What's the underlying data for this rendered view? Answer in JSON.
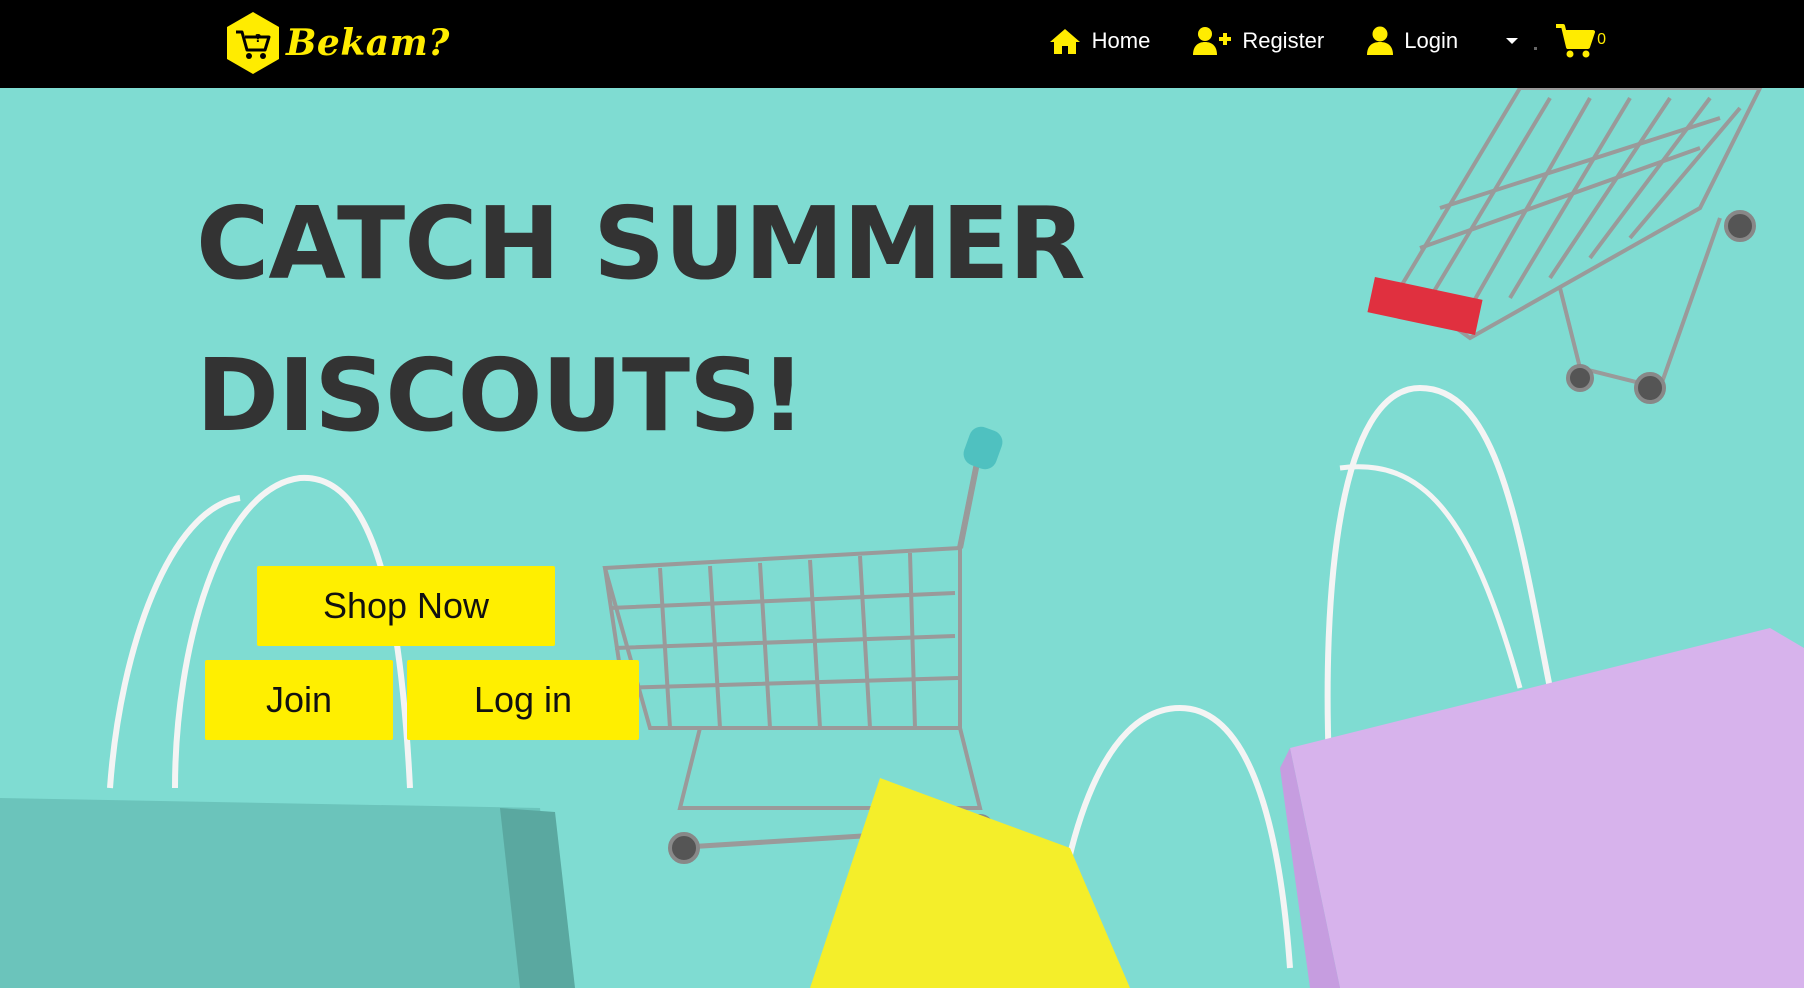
{
  "navbar": {
    "brand_text": "Bekam?",
    "home_label": "Home",
    "register_label": "Register",
    "login_label": "Login",
    "cart_count": "0"
  },
  "hero": {
    "title_line1": "Catch Summer",
    "title_line2": "Discouts!",
    "shop_now_label": "Shop Now",
    "join_label": "Join",
    "login_label": "Log in"
  },
  "colors": {
    "accent_yellow": "#ffec00",
    "navbar_bg": "#000000",
    "hero_bg": "#7fdcd2",
    "title_color": "#333333"
  }
}
